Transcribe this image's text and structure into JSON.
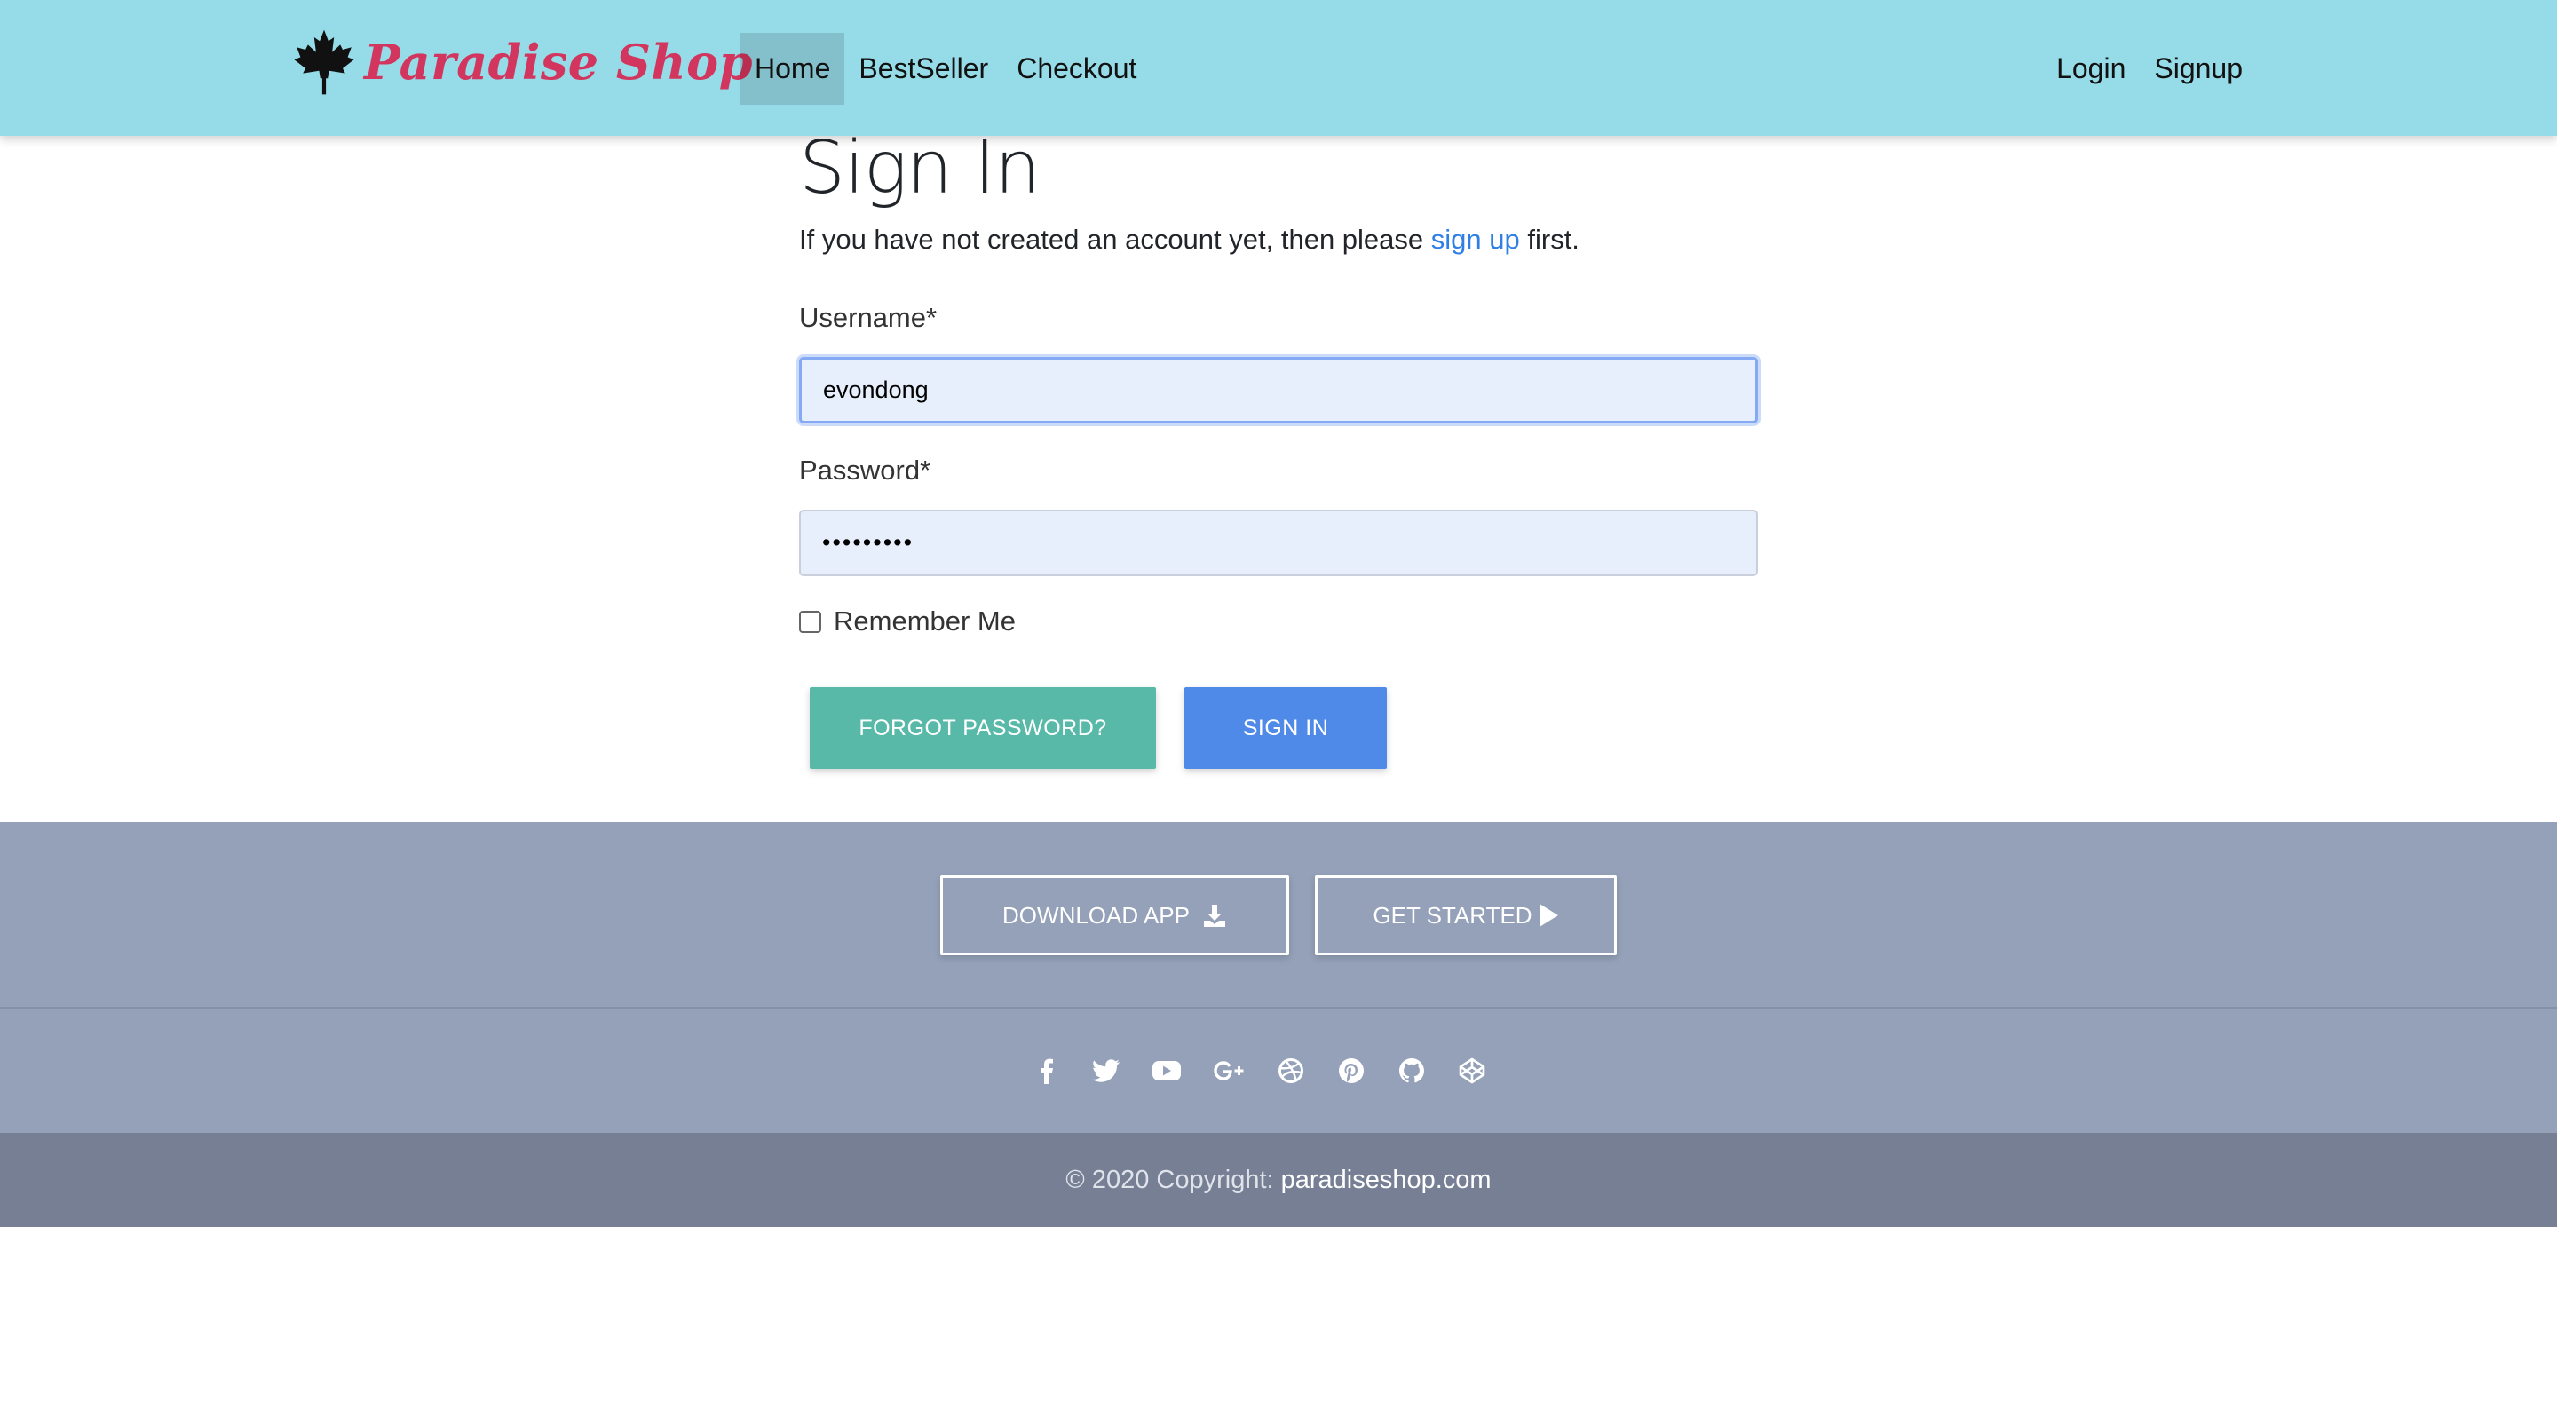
{
  "navbar": {
    "brand": "Paradise Shop",
    "brand_icon": "maple-leaf-icon",
    "links": [
      "Home",
      "BestSeller",
      "Checkout"
    ],
    "active_link": "Home",
    "right_links": [
      "Login",
      "Signup"
    ]
  },
  "signin": {
    "title": "Sign In",
    "intro_before": "If you have not created an account yet, then please",
    "intro_link": "sign up",
    "intro_after": "first.",
    "username_label": "Username*",
    "username_value": "evondong",
    "password_label": "Password*",
    "password_value": "•••••••••",
    "remember_label": "Remember Me",
    "remember_checked": false,
    "forgot_button": "FORGOT PASSWORD?",
    "signin_button": "SIGN IN"
  },
  "footer": {
    "download_button": "DOWNLOAD APP",
    "download_icon": "download-icon",
    "started_button": "GET STARTED",
    "started_icon": "play-icon",
    "social_icons": [
      "facebook-icon",
      "twitter-icon",
      "youtube-icon",
      "google-plus-icon",
      "dribbble-icon",
      "pinterest-icon",
      "github-icon",
      "codepen-icon"
    ],
    "copyright_text": "© 2020 Copyright:",
    "copyright_link": "paradiseshop.com"
  },
  "colors": {
    "navbar_bg": "#96dbe8",
    "brand": "#d2355d",
    "link": "#2f7fe6",
    "forgot_button": "#58b9a8",
    "signin_button": "#4f8ae8",
    "footer_bg": "#94a1b8",
    "copyright_bg": "#777f95"
  }
}
